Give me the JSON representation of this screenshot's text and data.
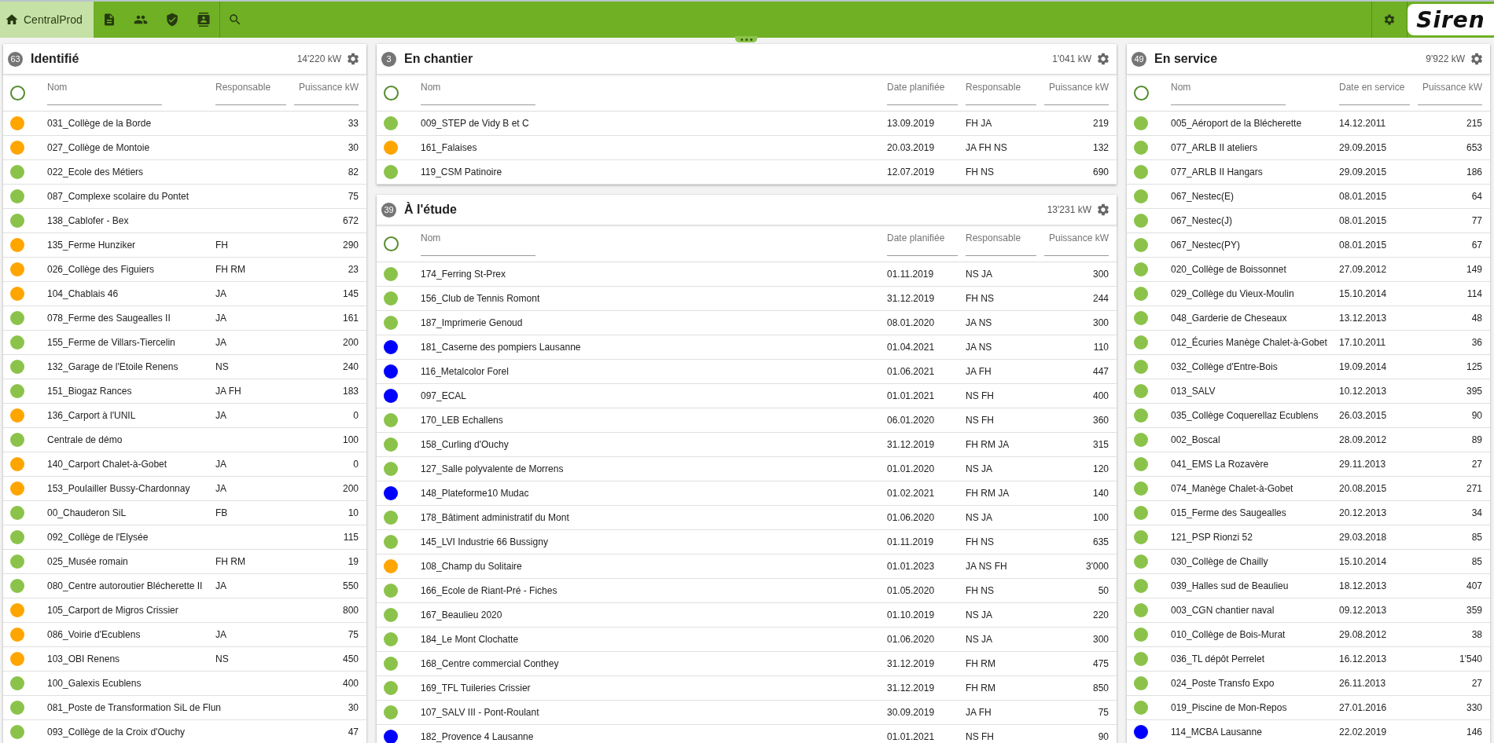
{
  "topbar": {
    "nav": [
      {
        "kind": "home",
        "label": "CentralProd",
        "selected": true
      },
      {
        "kind": "document",
        "selected": false
      },
      {
        "kind": "people",
        "selected": false
      },
      {
        "kind": "shield",
        "selected": false
      },
      {
        "kind": "contact",
        "selected": false
      },
      {
        "kind": "search",
        "selected": false
      }
    ],
    "logo": "Siren"
  },
  "columns": [
    {
      "panels": [
        {
          "count": "63",
          "title": "Identifié",
          "total": "14'220 kW",
          "all_selected": false,
          "headers": [
            {
              "label": "Nom",
              "kind": "name"
            },
            {
              "label": "Responsable",
              "kind": "responsable"
            },
            {
              "label": "Puissance kW",
              "kind": "power"
            }
          ],
          "rows": [
            {
              "color": "#ffa500",
              "name": "031_Collège de la Borde",
              "power": "33"
            },
            {
              "color": "#ffa500",
              "name": "027_Collège de Montoie",
              "power": "30"
            },
            {
              "color": "#8bc34a",
              "name": "022_Ecole des Métiers",
              "power": "82"
            },
            {
              "color": "#8bc34a",
              "name": "087_Complexe scolaire du Pontet",
              "power": "75"
            },
            {
              "color": "#8bc34a",
              "name": "138_Cablofer - Bex",
              "power": "672"
            },
            {
              "color": "#ffa500",
              "name": "135_Ferme Hunziker",
              "responsable": "FH",
              "power": "290"
            },
            {
              "color": "#ffa500",
              "name": "026_Collège des Figuiers",
              "responsable": "FH RM",
              "power": "23"
            },
            {
              "color": "#ffa500",
              "name": "104_Chablais 46",
              "responsable": "JA",
              "power": "145"
            },
            {
              "color": "#8bc34a",
              "name": "078_Ferme des Saugealles II",
              "responsable": "JA",
              "power": "161"
            },
            {
              "color": "#8bc34a",
              "name": "155_Ferme de Villars-Tiercelin",
              "responsable": "JA",
              "power": "200"
            },
            {
              "color": "#8bc34a",
              "name": "132_Garage de l'Etoile Renens",
              "responsable": "NS",
              "power": "240"
            },
            {
              "color": "#8bc34a",
              "name": "151_Biogaz Rances",
              "responsable": "JA FH",
              "power": "183"
            },
            {
              "color": "#ffa500",
              "name": "136_Carport à l'UNIL",
              "responsable": "JA",
              "power": "0"
            },
            {
              "color": "#8bc34a",
              "name": "Centrale de démo",
              "power": "100"
            },
            {
              "color": "#ffa500",
              "name": "140_Carport Chalet-à-Gobet",
              "responsable": "JA",
              "power": "0"
            },
            {
              "color": "#ffa500",
              "name": "153_Poulailler Bussy-Chardonnay",
              "responsable": "JA",
              "power": "200"
            },
            {
              "color": "#8bc34a",
              "name": "00_Chauderon SiL",
              "responsable": "FB",
              "power": "10"
            },
            {
              "color": "#8bc34a",
              "name": "092_Collège de l'Elysée",
              "power": "115"
            },
            {
              "color": "#8bc34a",
              "name": "025_Musée romain",
              "responsable": "FH RM",
              "power": "19"
            },
            {
              "color": "#8bc34a",
              "name": "080_Centre autoroutier Blécherette II",
              "responsable": "JA",
              "power": "550"
            },
            {
              "color": "#ffa500",
              "name": "105_Carport de Migros Crissier",
              "power": "800"
            },
            {
              "color": "#ffa500",
              "name": "086_Voirie d'Ecublens",
              "responsable": "JA",
              "power": "75"
            },
            {
              "color": "#ffa500",
              "name": "103_OBI Renens",
              "responsable": "NS",
              "power": "450"
            },
            {
              "color": "#8bc34a",
              "name": "100_Galexis Ecublens",
              "power": "400"
            },
            {
              "color": "#8bc34a",
              "name": "081_Poste de Transformation SiL de Flun",
              "power": "30"
            },
            {
              "color": "#8bc34a",
              "name": "093_Collège de la Croix d'Ouchy",
              "power": "47"
            }
          ]
        }
      ]
    },
    {
      "panels": [
        {
          "count": "3",
          "title": "En chantier",
          "total": "1'041 kW",
          "all_selected": false,
          "headers": [
            {
              "label": "Nom",
              "kind": "name"
            },
            {
              "label": "Date planifiée",
              "kind": "date"
            },
            {
              "label": "Responsable",
              "kind": "responsable"
            },
            {
              "label": "Puissance kW",
              "kind": "power"
            }
          ],
          "rows": [
            {
              "color": "#8bc34a",
              "name": "009_STEP de Vidy B et C",
              "date": "13.09.2019",
              "responsable": "FH JA",
              "power": "219"
            },
            {
              "color": "#ffa500",
              "name": "161_Falaises",
              "date": "20.03.2019",
              "responsable": "JA FH NS",
              "power": "132"
            },
            {
              "color": "#8bc34a",
              "name": "119_CSM Patinoire",
              "date": "12.07.2019",
              "responsable": "FH NS",
              "power": "690"
            }
          ]
        },
        {
          "count": "39",
          "title": "À l'étude",
          "total": "13'231 kW",
          "all_selected": false,
          "headers": [
            {
              "label": "Nom",
              "kind": "name"
            },
            {
              "label": "Date planifiée",
              "kind": "date"
            },
            {
              "label": "Responsable",
              "kind": "responsable"
            },
            {
              "label": "Puissance kW",
              "kind": "power"
            }
          ],
          "rows": [
            {
              "color": "#8bc34a",
              "name": "174_Ferring St-Prex",
              "date": "01.11.2019",
              "responsable": "NS JA",
              "power": "300"
            },
            {
              "color": "#8bc34a",
              "name": "156_Club de Tennis Romont",
              "date": "31.12.2019",
              "responsable": "FH NS",
              "power": "244"
            },
            {
              "color": "#8bc34a",
              "name": "187_Imprimerie Genoud",
              "date": "08.01.2020",
              "responsable": "JA NS",
              "power": "300"
            },
            {
              "color": "#0000ff",
              "name": "181_Caserne des pompiers Lausanne",
              "date": "01.04.2021",
              "responsable": "JA NS",
              "power": "110"
            },
            {
              "color": "#0000ff",
              "name": "116_Metalcolor Forel",
              "date": "01.06.2021",
              "responsable": "JA FH",
              "power": "447"
            },
            {
              "color": "#0000ff",
              "name": "097_ECAL",
              "date": "01.01.2021",
              "responsable": "NS FH",
              "power": "400"
            },
            {
              "color": "#8bc34a",
              "name": "170_LEB Echallens",
              "date": "06.01.2020",
              "responsable": "NS FH",
              "power": "360"
            },
            {
              "color": "#8bc34a",
              "name": "158_Curling d'Ouchy",
              "date": "31.12.2019",
              "responsable": "FH RM JA",
              "power": "315"
            },
            {
              "color": "#8bc34a",
              "name": "127_Salle polyvalente de Morrens",
              "date": "01.01.2020",
              "responsable": "NS JA",
              "power": "120"
            },
            {
              "color": "#0000ff",
              "name": "148_Plateforme10 Mudac",
              "date": "01.02.2021",
              "responsable": "FH RM JA",
              "power": "140"
            },
            {
              "color": "#8bc34a",
              "name": "178_Bâtiment administratif du Mont",
              "date": "01.06.2020",
              "responsable": "NS JA",
              "power": "100"
            },
            {
              "color": "#8bc34a",
              "name": "145_LVI Industrie 66 Bussigny",
              "date": "01.11.2019",
              "responsable": "FH NS",
              "power": "635"
            },
            {
              "color": "#ffa500",
              "name": "108_Champ du Solitaire",
              "date": "01.01.2023",
              "responsable": "JA NS FH",
              "power": "3'000"
            },
            {
              "color": "#8bc34a",
              "name": "166_Ecole de Riant-Pré - Fiches",
              "date": "01.05.2020",
              "responsable": "FH NS",
              "power": "50"
            },
            {
              "color": "#8bc34a",
              "name": "167_Beaulieu 2020",
              "date": "01.10.2019",
              "responsable": "NS JA",
              "power": "220"
            },
            {
              "color": "#8bc34a",
              "name": "184_Le Mont Clochatte",
              "date": "01.06.2020",
              "responsable": "NS JA",
              "power": "300"
            },
            {
              "color": "#8bc34a",
              "name": "168_Centre commercial Conthey",
              "date": "31.12.2019",
              "responsable": "FH RM",
              "power": "475"
            },
            {
              "color": "#8bc34a",
              "name": "169_TFL Tuileries Crissier",
              "date": "31.12.2019",
              "responsable": "FH RM",
              "power": "850"
            },
            {
              "color": "#8bc34a",
              "name": "107_SALV III - Pont-Roulant",
              "date": "30.09.2019",
              "responsable": "JA FH",
              "power": "75"
            },
            {
              "color": "#0000ff",
              "name": "182_Provence 4 Lausanne",
              "date": "01.01.2021",
              "responsable": "NS FH",
              "power": "90"
            }
          ]
        }
      ]
    },
    {
      "panels": [
        {
          "count": "49",
          "title": "En service",
          "total": "9'922 kW",
          "all_selected": false,
          "headers": [
            {
              "label": "Nom",
              "kind": "name"
            },
            {
              "label": "Date en service",
              "kind": "date"
            },
            {
              "label": "Puissance kW",
              "kind": "power"
            }
          ],
          "rows": [
            {
              "color": "#8bc34a",
              "name": "005_Aéroport de la Blécherette",
              "date": "14.12.2011",
              "power": "215"
            },
            {
              "color": "#8bc34a",
              "name": "077_ARLB II ateliers",
              "date": "29.09.2015",
              "power": "653"
            },
            {
              "color": "#8bc34a",
              "name": "077_ARLB II Hangars",
              "date": "29.09.2015",
              "power": "186"
            },
            {
              "color": "#8bc34a",
              "name": "067_Nestec(E)",
              "date": "08.01.2015",
              "power": "64"
            },
            {
              "color": "#8bc34a",
              "name": "067_Nestec(J)",
              "date": "08.01.2015",
              "power": "77"
            },
            {
              "color": "#8bc34a",
              "name": "067_Nestec(PY)",
              "date": "08.01.2015",
              "power": "67"
            },
            {
              "color": "#8bc34a",
              "name": "020_Collège de Boissonnet",
              "date": "27.09.2012",
              "power": "149"
            },
            {
              "color": "#8bc34a",
              "name": "029_Collège du Vieux-Moulin",
              "date": "15.10.2014",
              "power": "114"
            },
            {
              "color": "#8bc34a",
              "name": "048_Garderie de Cheseaux",
              "date": "13.12.2013",
              "power": "48"
            },
            {
              "color": "#8bc34a",
              "name": "012_Écuries Manège Chalet-à-Gobet",
              "date": "17.10.2011",
              "power": "36"
            },
            {
              "color": "#8bc34a",
              "name": "032_Collège d'Entre-Bois",
              "date": "19.09.2014",
              "power": "125"
            },
            {
              "color": "#8bc34a",
              "name": "013_SALV",
              "date": "10.12.2013",
              "power": "395"
            },
            {
              "color": "#8bc34a",
              "name": "035_Collège Coquerellaz Ecublens",
              "date": "26.03.2015",
              "power": "90"
            },
            {
              "color": "#8bc34a",
              "name": "002_Boscal",
              "date": "28.09.2012",
              "power": "89"
            },
            {
              "color": "#8bc34a",
              "name": "041_EMS La Rozavère",
              "date": "29.11.2013",
              "power": "27"
            },
            {
              "color": "#8bc34a",
              "name": "074_Manège Chalet-à-Gobet",
              "date": "20.08.2015",
              "power": "271"
            },
            {
              "color": "#8bc34a",
              "name": "015_Ferme des Saugealles",
              "date": "20.12.2013",
              "power": "34"
            },
            {
              "color": "#8bc34a",
              "name": "121_PSP Rionzi 52",
              "date": "29.03.2018",
              "power": "85"
            },
            {
              "color": "#8bc34a",
              "name": "030_Collège de Chailly",
              "date": "15.10.2014",
              "power": "85"
            },
            {
              "color": "#8bc34a",
              "name": "039_Halles sud de Beaulieu",
              "date": "18.12.2013",
              "power": "407"
            },
            {
              "color": "#8bc34a",
              "name": "003_CGN chantier naval",
              "date": "09.12.2013",
              "power": "359"
            },
            {
              "color": "#8bc34a",
              "name": "010_Collège de Bois-Murat",
              "date": "29.08.2012",
              "power": "38"
            },
            {
              "color": "#8bc34a",
              "name": "036_TL dépôt Perrelet",
              "date": "16.12.2013",
              "power": "1'540"
            },
            {
              "color": "#8bc34a",
              "name": "024_Poste Transfo Expo",
              "date": "26.11.2013",
              "power": "27"
            },
            {
              "color": "#8bc34a",
              "name": "019_Piscine de Mon-Repos",
              "date": "27.01.2016",
              "power": "330"
            },
            {
              "color": "#0000ff",
              "name": "114_MCBA Lausanne",
              "date": "22.02.2019",
              "power": "146"
            }
          ]
        }
      ]
    }
  ]
}
